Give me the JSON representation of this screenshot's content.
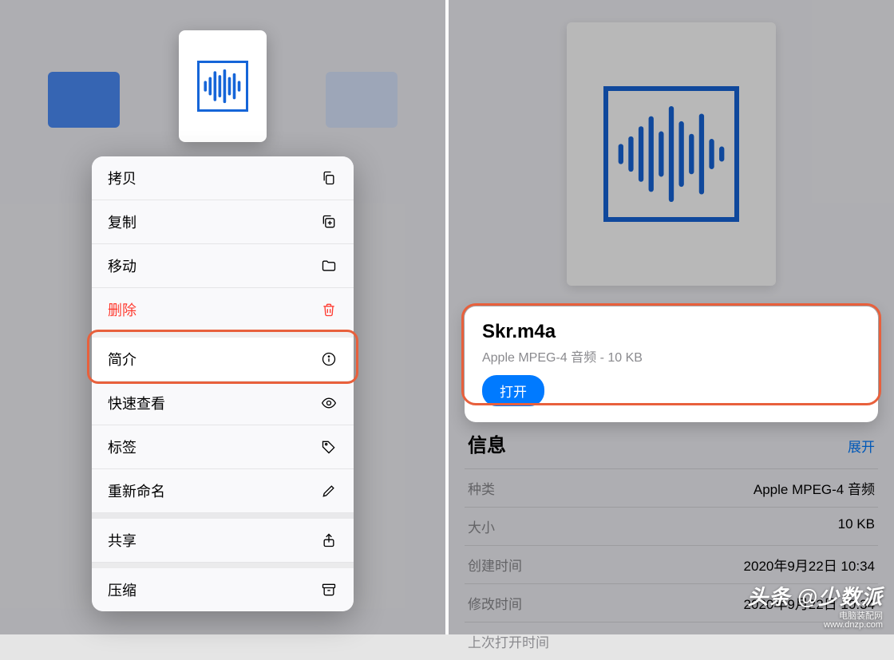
{
  "left": {
    "menu": [
      {
        "label": "拷贝",
        "icon": "copy-icon",
        "destructive": false,
        "sep": false
      },
      {
        "label": "复制",
        "icon": "duplicate-icon",
        "destructive": false,
        "sep": false
      },
      {
        "label": "移动",
        "icon": "folder-icon",
        "destructive": false,
        "sep": false
      },
      {
        "label": "删除",
        "icon": "trash-icon",
        "destructive": true,
        "sep": false
      },
      {
        "label": "简介",
        "icon": "info-icon",
        "destructive": false,
        "sep": true,
        "highlighted": true
      },
      {
        "label": "快速查看",
        "icon": "eye-icon",
        "destructive": false,
        "sep": false
      },
      {
        "label": "标签",
        "icon": "tag-icon",
        "destructive": false,
        "sep": false
      },
      {
        "label": "重新命名",
        "icon": "pencil-icon",
        "destructive": false,
        "sep": false
      },
      {
        "label": "共享",
        "icon": "share-icon",
        "destructive": false,
        "sep": true
      },
      {
        "label": "压缩",
        "icon": "archive-icon",
        "destructive": false,
        "sep": true
      }
    ]
  },
  "right": {
    "file_name": "Skr.m4a",
    "file_subtitle": "Apple MPEG-4 音频 - 10 KB",
    "open_label": "打开",
    "info_title": "信息",
    "expand_label": "展开",
    "rows": [
      {
        "label": "种类",
        "value": "Apple MPEG-4 音频"
      },
      {
        "label": "大小",
        "value": "10 KB"
      },
      {
        "label": "创建时间",
        "value": "2020年9月22日 10:34"
      },
      {
        "label": "修改时间",
        "value": "2020年9月22日 10:34"
      },
      {
        "label": "上次打开时间",
        "value": ""
      }
    ]
  },
  "watermark": {
    "main": "头条 @少数派",
    "sub_a": "电脑装配网",
    "sub_b": "www.dnzp.com"
  }
}
